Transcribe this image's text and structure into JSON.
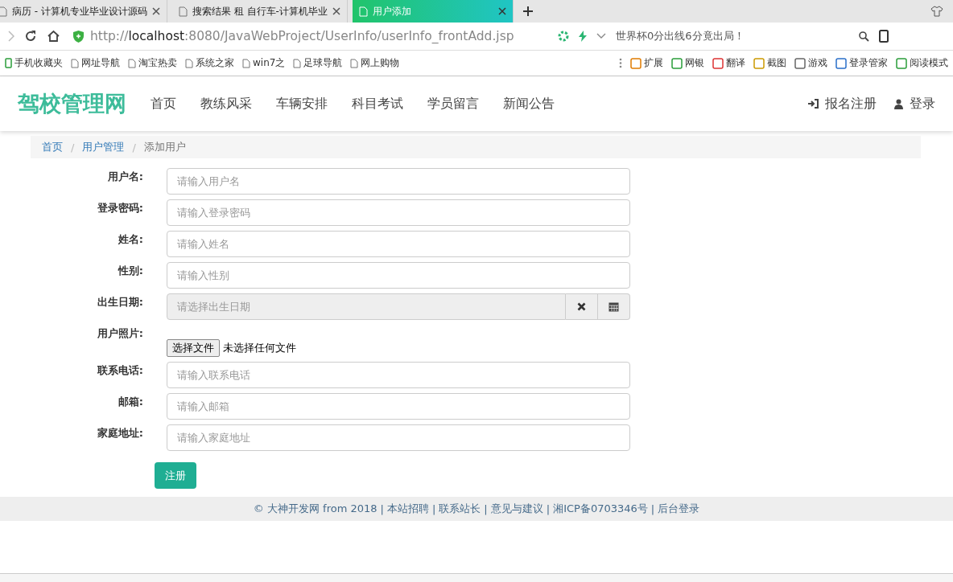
{
  "browser": {
    "tabs": [
      {
        "title": "病历 - 计算机专业毕业设计源码",
        "selected": false
      },
      {
        "title": "搜索结果 租 自行车-计算机毕业",
        "selected": false
      },
      {
        "title": "用户添加",
        "selected": true
      }
    ],
    "address": {
      "url": "http://**localhost**:8080/JavaWebProject/UserInfo/userInfo_frontAdd.jsp"
    },
    "news_hint": "世界杯0分出线6分竟出局！",
    "bookmarks": [
      {
        "label": "手机收藏夹",
        "kind": "folder"
      },
      {
        "label": "网址导航",
        "kind": "page"
      },
      {
        "label": "淘宝热卖",
        "kind": "page"
      },
      {
        "label": "系统之家",
        "kind": "page"
      },
      {
        "label": "win7之",
        "kind": "page"
      },
      {
        "label": "足球导航",
        "kind": "page"
      },
      {
        "label": "网上购物",
        "kind": "page"
      }
    ],
    "extensions": [
      "扩展",
      "网银",
      "翻译",
      "截图",
      "游戏",
      "登录管家",
      "阅读模式"
    ]
  },
  "site": {
    "logo": "驾校管理网",
    "nav": [
      "首页",
      "教练风采",
      "车辆安排",
      "科目考试",
      "学员留言",
      "新闻公告"
    ],
    "account_links": [
      {
        "label": "报名注册",
        "kind": "signin"
      },
      {
        "label": "登录",
        "kind": "user"
      }
    ],
    "breadcrumb": [
      {
        "label": "首页",
        "current": false
      },
      {
        "label": "用户管理",
        "current": false
      },
      {
        "label": "添加用户",
        "current": true
      }
    ],
    "breadcrumb_separator": "/",
    "form": {
      "fields": [
        {
          "label": "用户名:",
          "kind": "text",
          "placeholder": "请输入用户名"
        },
        {
          "label": "登录密码:",
          "kind": "text",
          "placeholder": "请输入登录密码"
        },
        {
          "label": "姓名:",
          "kind": "text",
          "placeholder": "请输入姓名"
        },
        {
          "label": "性别:",
          "kind": "text",
          "placeholder": "请输入性别"
        },
        {
          "label": "出生日期:",
          "kind": "date",
          "placeholder": "请选择出生日期"
        },
        {
          "label": "用户照片:",
          "kind": "file",
          "button": "选择文件",
          "status": "未选择任何文件"
        },
        {
          "label": "联系电话:",
          "kind": "text",
          "placeholder": "请输入联系电话"
        },
        {
          "label": "邮箱:",
          "kind": "text",
          "placeholder": "请输入邮箱"
        },
        {
          "label": "家庭地址:",
          "kind": "text",
          "placeholder": "请输入家庭地址"
        }
      ],
      "submit": "注册"
    },
    "footer": {
      "items": [
        "© 大神开发网 from 2018",
        "本站招聘",
        "联系站长",
        "意见与建议",
        "湘ICP备0703346号",
        "后台登录"
      ],
      "separator": "|"
    }
  }
}
